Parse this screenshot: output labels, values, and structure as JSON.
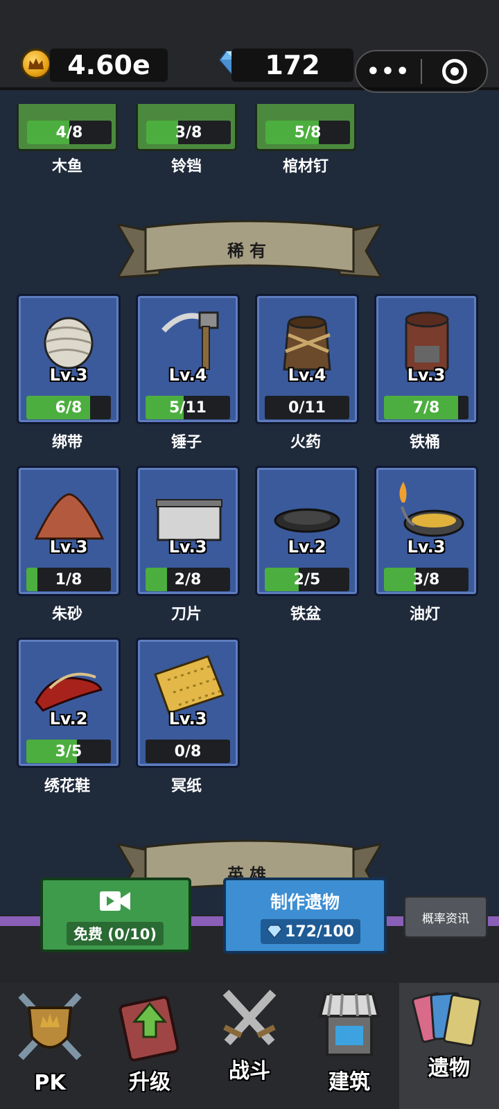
{
  "header": {
    "coin_value": "4.60e",
    "gem_value": "172",
    "more_label": "•••"
  },
  "partial_row": [
    {
      "name": "木鱼",
      "progress_text": "4/8",
      "progress": 0.5
    },
    {
      "name": "铃铛",
      "progress_text": "3/8",
      "progress": 0.375
    },
    {
      "name": "棺材钉",
      "progress_text": "5/8",
      "progress": 0.625
    }
  ],
  "rare_section": {
    "title": "稀有",
    "items": [
      {
        "name": "绑带",
        "level": "Lv.3",
        "progress_text": "6/8",
        "progress": 0.75,
        "icon": "bandage-icon"
      },
      {
        "name": "锤子",
        "level": "Lv.4",
        "progress_text": "5/11",
        "progress": 0.45,
        "icon": "hammer-icon"
      },
      {
        "name": "火药",
        "level": "Lv.4",
        "progress_text": "0/11",
        "progress": 0,
        "icon": "gunpowder-icon"
      },
      {
        "name": "铁桶",
        "level": "Lv.3",
        "progress_text": "7/8",
        "progress": 0.875,
        "icon": "iron-barrel-icon"
      },
      {
        "name": "朱砂",
        "level": "Lv.3",
        "progress_text": "1/8",
        "progress": 0.125,
        "icon": "cinnabar-icon"
      },
      {
        "name": "刀片",
        "level": "Lv.3",
        "progress_text": "2/8",
        "progress": 0.25,
        "icon": "blade-icon"
      },
      {
        "name": "铁盆",
        "level": "Lv.2",
        "progress_text": "2/5",
        "progress": 0.4,
        "icon": "iron-basin-icon"
      },
      {
        "name": "油灯",
        "level": "Lv.3",
        "progress_text": "3/8",
        "progress": 0.375,
        "icon": "oil-lamp-icon"
      },
      {
        "name": "绣花鞋",
        "level": "Lv.2",
        "progress_text": "3/5",
        "progress": 0.6,
        "icon": "embroidered-shoes-icon"
      },
      {
        "name": "冥纸",
        "level": "Lv.3",
        "progress_text": "0/8",
        "progress": 0,
        "icon": "joss-paper-icon"
      }
    ]
  },
  "hero_section": {
    "title": "英雄"
  },
  "actions": {
    "free_label": "免费 (0/10)",
    "make_title": "制作遗物",
    "make_cost": "172/100",
    "rate_info": "概率资讯"
  },
  "nav": [
    {
      "label": "PK",
      "icon": "shield-crossed-icon"
    },
    {
      "label": "升级",
      "icon": "upgrade-book-icon"
    },
    {
      "label": "战斗",
      "icon": "crossed-swords-icon"
    },
    {
      "label": "建筑",
      "icon": "shop-building-icon"
    },
    {
      "label": "遗物",
      "icon": "relic-cards-icon",
      "active": true
    }
  ],
  "colors": {
    "background": "#1f2a3b",
    "card_blue": "#3b5a9c",
    "card_green": "#4b8a3e",
    "progress_green": "#4cae3e",
    "button_green": "#3f9b4c",
    "button_blue": "#3d8ed2"
  }
}
